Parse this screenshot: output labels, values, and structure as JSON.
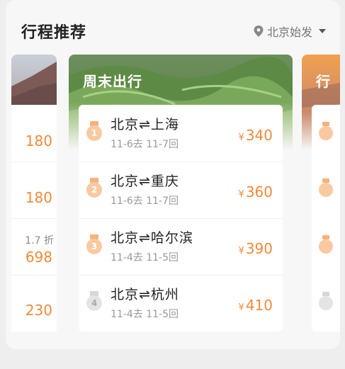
{
  "header": {
    "title": "行程推荐",
    "city": "北京始发"
  },
  "colors": {
    "accent": "#f08a3a",
    "medal_orange": "#f6b27a",
    "medal_silver": "#c9c9c9"
  },
  "left_card": {
    "rows": [
      {
        "price": "¥180",
        "discount": ""
      },
      {
        "price": "¥180",
        "discount": ""
      },
      {
        "price": "¥698",
        "discount": "1.7折"
      },
      {
        "price": "¥230",
        "discount": ""
      }
    ],
    "price_visible": [
      "180",
      "180",
      "698",
      "230"
    ],
    "discount_visible": "1.7 折"
  },
  "main_card": {
    "theme": "周末出行",
    "routes": [
      {
        "rank": "1",
        "name": "北京⇌上海",
        "dates": "11-6去  11-7回",
        "currency": "¥",
        "price": "340",
        "medal": "orange"
      },
      {
        "rank": "2",
        "name": "北京⇌重庆",
        "dates": "11-6去  11-7回",
        "currency": "¥",
        "price": "360",
        "medal": "orange"
      },
      {
        "rank": "3",
        "name": "北京⇌哈尔滨",
        "dates": "11-4去  11-5回",
        "currency": "¥",
        "price": "390",
        "medal": "orange"
      },
      {
        "rank": "4",
        "name": "北京⇌杭州",
        "dates": "11-4去  11-5回",
        "currency": "¥",
        "price": "410",
        "medal": "silver"
      }
    ]
  },
  "right_card": {
    "theme_partial": "行"
  }
}
